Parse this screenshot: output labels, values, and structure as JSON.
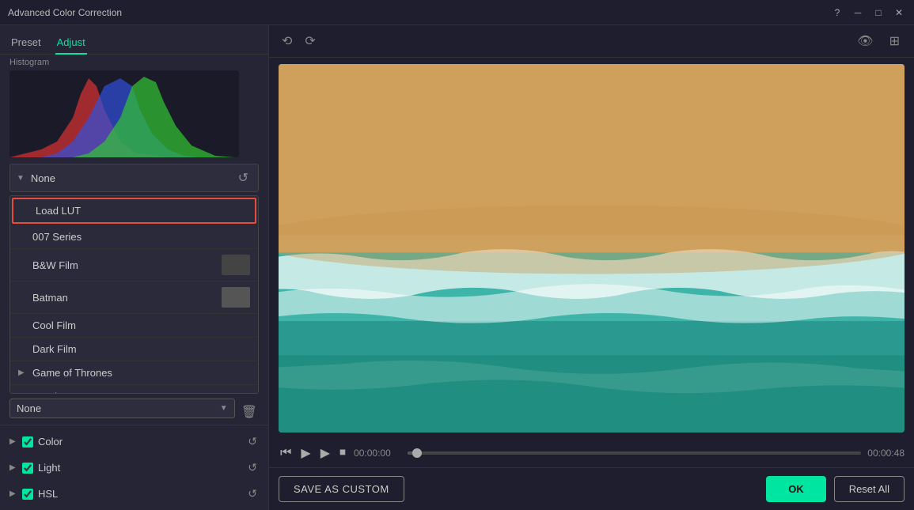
{
  "window": {
    "title": "Advanced Color Correction"
  },
  "tabs": {
    "preset": "Preset",
    "adjust": "Adjust",
    "active": "adjust"
  },
  "toolbar": {
    "undo": "↩",
    "redo": "↪"
  },
  "histogram": {
    "label": "Histogram"
  },
  "dropdown": {
    "none_label": "None",
    "reset_icon": "↺"
  },
  "preset_list": {
    "items": [
      {
        "id": "load-lut",
        "label": "Load LUT",
        "has_thumbnail": false,
        "is_load_lut": true
      },
      {
        "id": "007-series",
        "label": "007 Series",
        "has_thumbnail": false
      },
      {
        "id": "bw-film",
        "label": "B&W Film",
        "has_thumbnail": true
      },
      {
        "id": "batman",
        "label": "Batman",
        "has_thumbnail": true
      },
      {
        "id": "cool-film",
        "label": "Cool Film",
        "has_thumbnail": false
      },
      {
        "id": "dark-film",
        "label": "Dark Film",
        "has_thumbnail": false
      },
      {
        "id": "game-of-thrones",
        "label": "Game of Thrones",
        "has_thumbnail": false,
        "has_expand": true
      },
      {
        "id": "gravity",
        "label": "Gravity",
        "has_thumbnail": false,
        "has_expand_down": true
      }
    ]
  },
  "lut_selector": {
    "value": "None",
    "placeholder": "None"
  },
  "corrections": [
    {
      "id": "color",
      "label": "Color",
      "checked": true,
      "expandable": false
    },
    {
      "id": "light",
      "label": "Light",
      "checked": true,
      "expandable": false
    },
    {
      "id": "hsl",
      "label": "HSL",
      "checked": true,
      "expandable": false
    }
  ],
  "video": {
    "current_time": "00:00:00",
    "end_time": "00:00:48",
    "progress_percent": 2
  },
  "buttons": {
    "save_as_custom": "SAVE AS CUSTOM",
    "ok": "OK",
    "reset_all": "Reset All"
  },
  "icons": {
    "undo": "⟲",
    "redo": "⟳",
    "play": "▶",
    "pause": "⏸",
    "stop": "⏹",
    "step_back": "⏮",
    "eye": "👁",
    "layers": "⊞",
    "help": "?",
    "minimize": "─",
    "maximize": "□",
    "close": "✕",
    "reset": "↺",
    "delete": "🗑",
    "chevron_right": "▶",
    "chevron_down": "▼"
  },
  "colors": {
    "accent": "#00e5a0",
    "active_tab": "#00e5a0",
    "load_lut_border": "#e74c3c"
  }
}
